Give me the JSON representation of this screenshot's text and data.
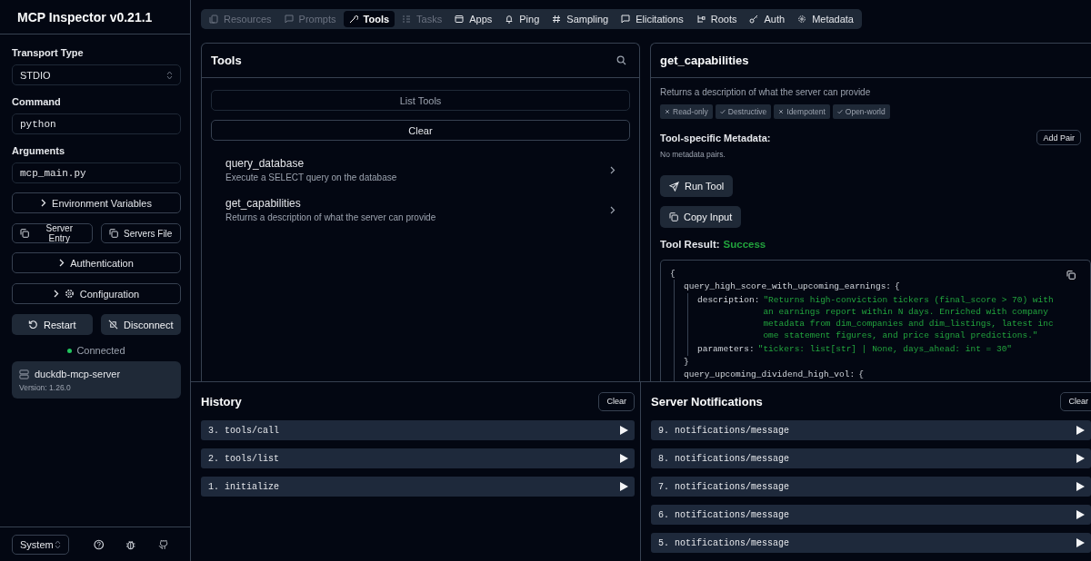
{
  "app": {
    "title": "MCP Inspector v0.21.1"
  },
  "sidebar": {
    "transport": {
      "label": "Transport Type",
      "value": "STDIO"
    },
    "command": {
      "label": "Command",
      "value": "python"
    },
    "arguments": {
      "label": "Arguments",
      "value": "mcp_main.py"
    },
    "env_button": "Environment Variables",
    "config_buttons": [
      "Server Entry",
      "Servers File"
    ],
    "auth_button": "Authentication",
    "configuration_button": "Configuration",
    "restart_button": "Restart",
    "disconnect_button": "Disconnect",
    "status": {
      "label": "Connected",
      "connected": true
    },
    "server": {
      "name": "duckdb-mcp-server",
      "version": "Version: 1.26.0"
    },
    "theme": {
      "value": "System"
    }
  },
  "tabs": [
    {
      "label": "Resources",
      "selected": false,
      "disabled": true
    },
    {
      "label": "Prompts",
      "selected": false,
      "disabled": true
    },
    {
      "label": "Tools",
      "selected": true,
      "disabled": false
    },
    {
      "label": "Tasks",
      "selected": false,
      "disabled": true
    },
    {
      "label": "Apps",
      "selected": false,
      "disabled": false
    },
    {
      "label": "Ping",
      "selected": false,
      "disabled": false
    },
    {
      "label": "Sampling",
      "selected": false,
      "disabled": false
    },
    {
      "label": "Elicitations",
      "selected": false,
      "disabled": false
    },
    {
      "label": "Roots",
      "selected": false,
      "disabled": false
    },
    {
      "label": "Auth",
      "selected": false,
      "disabled": false
    },
    {
      "label": "Metadata",
      "selected": false,
      "disabled": false
    }
  ],
  "tools_panel": {
    "title": "Tools",
    "list_button": "List Tools",
    "list_disabled": true,
    "clear_button": "Clear",
    "tools": [
      {
        "name": "query_database",
        "description": "Execute a SELECT query on the database"
      },
      {
        "name": "get_capabilities",
        "description": "Returns a description of what the server can provide"
      }
    ]
  },
  "detail": {
    "title": "get_capabilities",
    "description": "Returns a description of what the server can provide",
    "annotations": [
      {
        "label": "Read-only",
        "checked": false
      },
      {
        "label": "Destructive",
        "checked": true
      },
      {
        "label": "Idempotent",
        "checked": false
      },
      {
        "label": "Open-world",
        "checked": true
      }
    ],
    "metadata_title": "Tool-specific Metadata:",
    "add_pair_button": "Add Pair",
    "metadata_empty": "No metadata pairs.",
    "run_button": "Run Tool",
    "copy_button": "Copy Input",
    "result_label": "Tool Result:",
    "result_status": "Success",
    "result": {
      "open": "{",
      "entries": [
        {
          "key": "query_high_score_with_upcoming_earnings:",
          "open": "{",
          "close": "}",
          "children": [
            {
              "key": "description:",
              "value": "\"Returns high-conviction tickers (final_score > 70) with an earnings report within N days. Enriched with company metadata from dim_companies and dim_listings, latest income statement figures, and price signal predictions.\""
            },
            {
              "key": "parameters:",
              "value": "\"tickers: list[str] | None, days_ahead: int = 30\""
            }
          ]
        },
        {
          "key": "query_upcoming_dividend_high_vol:",
          "open": "{"
        }
      ]
    }
  },
  "history": {
    "title": "History",
    "clear_button": "Clear",
    "items": [
      "3. tools/call",
      "2. tools/list",
      "1. initialize"
    ]
  },
  "notifications": {
    "title": "Server Notifications",
    "clear_button": "Clear",
    "items": [
      "9. notifications/message",
      "8. notifications/message",
      "7. notifications/message",
      "6. notifications/message",
      "5. notifications/message"
    ]
  }
}
